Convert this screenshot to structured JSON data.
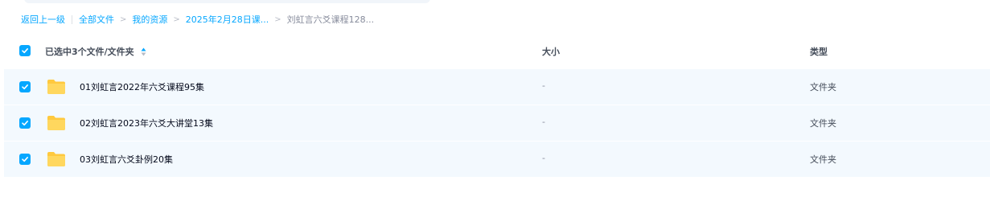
{
  "breadcrumb": {
    "back": "返回上一级",
    "items": [
      "全部文件",
      "我的资源",
      "2025年2月28日课..."
    ],
    "current": "刘虹言六爻课程128..."
  },
  "header": {
    "selected_label": "已选中3个文件/文件夹",
    "size_label": "大小",
    "type_label": "类型"
  },
  "files": [
    {
      "name": "01刘虹言2022年六爻课程95集",
      "size": "-",
      "type": "文件夹"
    },
    {
      "name": "02刘虹言2023年六爻大讲堂13集",
      "size": "-",
      "type": "文件夹"
    },
    {
      "name": "03刘虹言六爻卦例20集",
      "size": "-",
      "type": "文件夹"
    }
  ],
  "colors": {
    "accent": "#06a7ff",
    "row_selected_bg": "#f3f9fe",
    "folder": "#ffc93e"
  },
  "icons": {
    "checkbox": "check-icon",
    "folder": "folder-icon",
    "sort": "sort-icon"
  }
}
